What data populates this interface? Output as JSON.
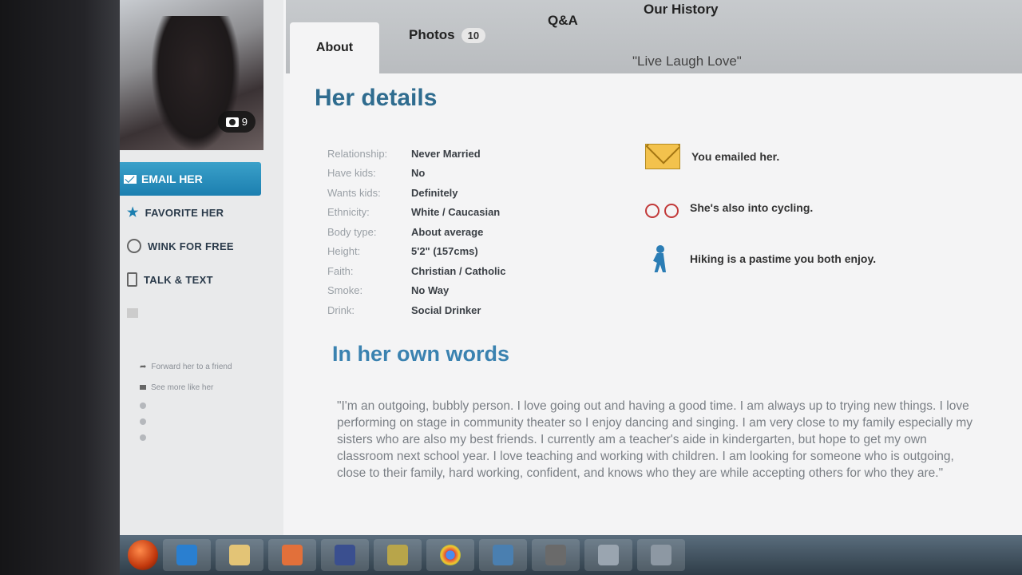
{
  "photo": {
    "count": "9"
  },
  "actions": {
    "email": "EMAIL HER",
    "favorite": "FAVORITE HER",
    "wink": "WINK FOR FREE",
    "talk": "TALK & TEXT"
  },
  "links": {
    "forward": "Forward her to a friend",
    "see_more": "See more like her"
  },
  "tabs": [
    {
      "label": "About"
    },
    {
      "label": "Photos",
      "badge": "10"
    },
    {
      "label": "Q&A"
    },
    {
      "label": "Our History"
    }
  ],
  "tagline": "\"Live Laugh Love\"",
  "details_title": "Her details",
  "details": [
    {
      "label": "Relationship:",
      "value": "Never Married"
    },
    {
      "label": "Have kids:",
      "value": "No"
    },
    {
      "label": "Wants kids:",
      "value": "Definitely"
    },
    {
      "label": "Ethnicity:",
      "value": "White / Caucasian"
    },
    {
      "label": "Body type:",
      "value": "About average"
    },
    {
      "label": "Height:",
      "value": "5'2\" (157cms)"
    },
    {
      "label": "Faith:",
      "value": "Christian / Catholic"
    },
    {
      "label": "Smoke:",
      "value": "No Way"
    },
    {
      "label": "Drink:",
      "value": "Social Drinker"
    }
  ],
  "features": [
    {
      "text": "You emailed her.",
      "icon": "envelope-icon"
    },
    {
      "text": "She's also into cycling.",
      "icon": "bicycle-icon"
    },
    {
      "text": "Hiking is a pastime you both enjoy.",
      "icon": "hiker-icon"
    }
  ],
  "own_words_title": "In her own words",
  "bio": "\"I'm an outgoing, bubbly person. I love going out and having a good time. I am always up to trying new things. I love performing on stage in community theater so I enjoy dancing and singing. I am very close to my family especially my sisters who are also my best friends. I currently am a teacher's aide in kindergarten, but hope to get my own classroom next school year. I love teaching and working with children. I am looking for someone who is outgoing, close to their family, hard working, confident, and knows who they are while accepting others for who they are.\""
}
